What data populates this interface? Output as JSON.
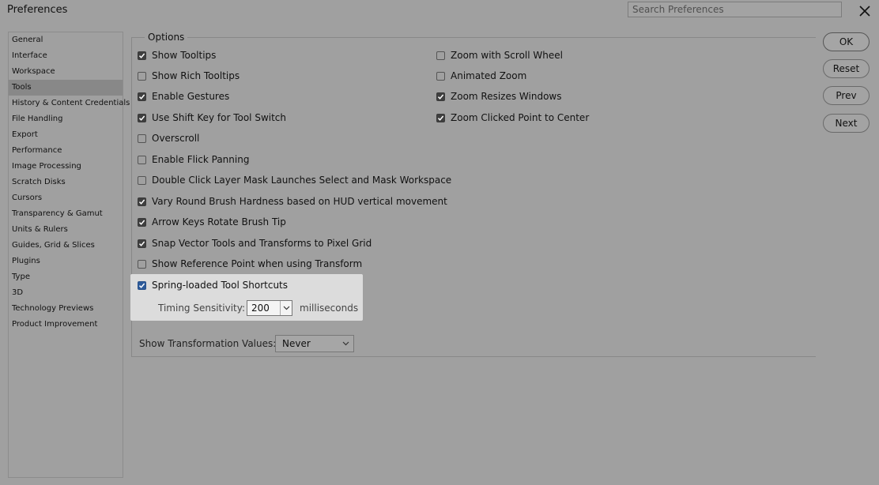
{
  "window": {
    "title": "Preferences"
  },
  "search": {
    "placeholder": "Search Preferences"
  },
  "sidebar": {
    "items": [
      {
        "label": "General"
      },
      {
        "label": "Interface"
      },
      {
        "label": "Workspace"
      },
      {
        "label": "Tools",
        "active": true
      },
      {
        "label": "History & Content Credentials"
      },
      {
        "label": "File Handling"
      },
      {
        "label": "Export"
      },
      {
        "label": "Performance"
      },
      {
        "label": "Image Processing"
      },
      {
        "label": "Scratch Disks"
      },
      {
        "label": "Cursors"
      },
      {
        "label": "Transparency & Gamut"
      },
      {
        "label": "Units & Rulers"
      },
      {
        "label": "Guides, Grid & Slices"
      },
      {
        "label": "Plugins"
      },
      {
        "label": "Type"
      },
      {
        "label": "3D"
      },
      {
        "label": "Technology Previews"
      },
      {
        "label": "Product Improvement"
      }
    ]
  },
  "options": {
    "group_label": "Options",
    "left": [
      {
        "label": "Show Tooltips",
        "checked": true
      },
      {
        "label": "Show Rich Tooltips",
        "checked": false
      },
      {
        "label": "Enable Gestures",
        "checked": true
      },
      {
        "label": "Use Shift Key for Tool Switch",
        "checked": true
      },
      {
        "label": "Overscroll",
        "checked": false
      },
      {
        "label": "Enable Flick Panning",
        "checked": false
      },
      {
        "label": "Double Click Layer Mask Launches Select and Mask Workspace",
        "checked": false
      },
      {
        "label": "Vary Round Brush Hardness based on HUD vertical movement",
        "checked": true
      },
      {
        "label": "Arrow Keys Rotate Brush Tip",
        "checked": true
      },
      {
        "label": "Snap Vector Tools and Transforms to Pixel Grid",
        "checked": true
      },
      {
        "label": "Show Reference Point when using Transform",
        "checked": false
      },
      {
        "label": "Spring-loaded Tool Shortcuts",
        "checked": true
      }
    ],
    "right": [
      {
        "label": "Zoom with Scroll Wheel",
        "checked": false
      },
      {
        "label": "Animated Zoom",
        "checked": false
      },
      {
        "label": "Zoom Resizes Windows",
        "checked": true
      },
      {
        "label": "Zoom Clicked Point to Center",
        "checked": true
      }
    ],
    "timing": {
      "label": "Timing Sensitivity:",
      "value": "200",
      "unit": "milliseconds"
    },
    "transformation": {
      "label": "Show Transformation Values:",
      "value": "Never"
    }
  },
  "buttons": {
    "ok": "OK",
    "reset": "Reset",
    "prev": "Prev",
    "next": "Next"
  },
  "colors": {
    "highlight": "#dcdcdc",
    "checkbox_checked": "#3f3f3f",
    "checkbox_active": "#2d5b9b"
  }
}
